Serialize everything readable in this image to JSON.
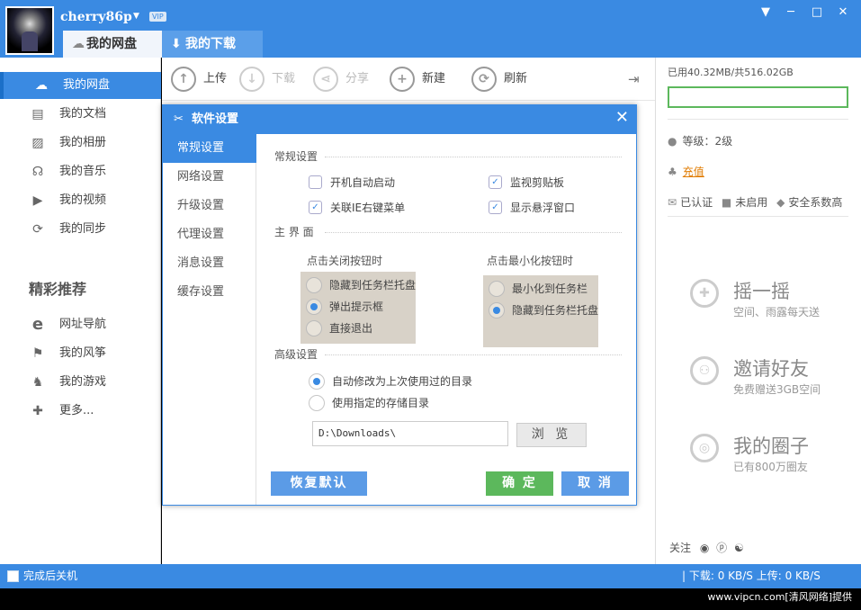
{
  "user": {
    "name": "cherry86p",
    "vip": "VIP"
  },
  "tabs": [
    {
      "label": "我的网盘"
    },
    {
      "label": "我的下载"
    }
  ],
  "window": {
    "menu": "▼",
    "min": "─",
    "max": "□",
    "close": "✕"
  },
  "sidebar": {
    "items": [
      {
        "label": "我的网盘",
        "icon": "cloud-icon"
      },
      {
        "label": "我的文档",
        "icon": "document-icon"
      },
      {
        "label": "我的相册",
        "icon": "photo-icon"
      },
      {
        "label": "我的音乐",
        "icon": "headphones-icon"
      },
      {
        "label": "我的视频",
        "icon": "video-icon"
      },
      {
        "label": "我的同步",
        "icon": "sync-icon"
      }
    ],
    "rec_title": "精彩推荐",
    "rec_items": [
      {
        "label": "网址导航",
        "icon": "ie-icon"
      },
      {
        "label": "我的风筝",
        "icon": "kite-icon"
      },
      {
        "label": "我的游戏",
        "icon": "chess-icon"
      },
      {
        "label": "更多...",
        "icon": "puzzle-icon"
      }
    ]
  },
  "toolbar": {
    "upload": "上传",
    "download": "下载",
    "share": "分享",
    "new": "新建",
    "refresh": "刷新"
  },
  "right": {
    "quota": "已用40.32MB/共516.02GB",
    "level": "等级：2级",
    "recharge": "充值",
    "verified": "已认证",
    "not_enabled": "未启用",
    "safety": "安全系数高",
    "promos": [
      {
        "title": "摇一摇",
        "sub": "空间、雨露每天送",
        "icon": "puzzle-icon"
      },
      {
        "title": "邀请好友",
        "sub": "免费赠送3GB空间",
        "icon": "friends-icon"
      },
      {
        "title": "我的圈子",
        "sub": "已有800万圈友",
        "icon": "circle-icon"
      }
    ],
    "follow": "关注"
  },
  "statusbar": {
    "shutdown": "完成后关机",
    "speed": "| 下载: 0 KB/S   上传: 0 KB/S"
  },
  "watermark": "www.vipcn.com[清风网络]提供",
  "dialog": {
    "title": "软件设置",
    "nav": [
      "常规设置",
      "网络设置",
      "升级设置",
      "代理设置",
      "消息设置",
      "缓存设置"
    ],
    "general": {
      "heading": "常规设置",
      "autostart": "开机自动启动",
      "autostart_checked": false,
      "monitor_clip": "监视剪贴板",
      "monitor_clip_checked": true,
      "ie_menu": "关联IE右键菜单",
      "ie_menu_checked": true,
      "float_win": "显示悬浮窗口",
      "float_win_checked": true
    },
    "main_ui": {
      "heading": "主 界 面",
      "close_label": "点击关闭按钮时",
      "close_opts": [
        "隐藏到任务栏托盘",
        "弹出提示框",
        "直接退出"
      ],
      "close_selected": 1,
      "min_label": "点击最小化按钮时",
      "min_opts": [
        "最小化到任务栏",
        "隐藏到任务栏托盘"
      ],
      "min_selected": 1
    },
    "advanced": {
      "heading": "高级设置",
      "opt1": "自动修改为上次使用过的目录",
      "opt2": "使用指定的存储目录",
      "path": "D:\\Downloads\\",
      "browse": "浏 览"
    },
    "buttons": {
      "restore": "恢复默认",
      "ok": "确 定",
      "cancel": "取 消"
    }
  }
}
